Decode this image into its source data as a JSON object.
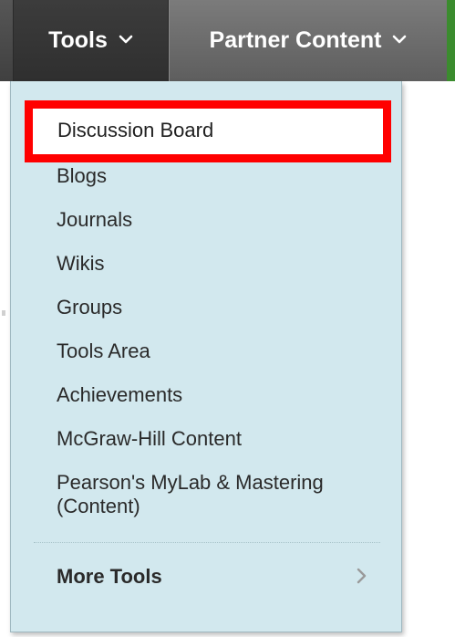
{
  "nav": {
    "tools_label": "Tools",
    "partner_label": "Partner Content"
  },
  "menu": {
    "items": [
      "Discussion Board",
      "Blogs",
      "Journals",
      "Wikis",
      "Groups",
      "Tools Area",
      "Achievements",
      "McGraw-Hill Content",
      "Pearson's MyLab & Mastering (Content)"
    ],
    "more_label": "More Tools"
  },
  "icons": {
    "tools_chevron": "chevron-down-icon",
    "partner_chevron": "chevron-down-icon",
    "more_chevron": "chevron-right-icon"
  },
  "colors": {
    "highlight_border": "#ff0000",
    "dropdown_bg": "#d2e8ee",
    "nav_bg": "#4f4f4f",
    "accent_green": "#3b8c2e"
  }
}
